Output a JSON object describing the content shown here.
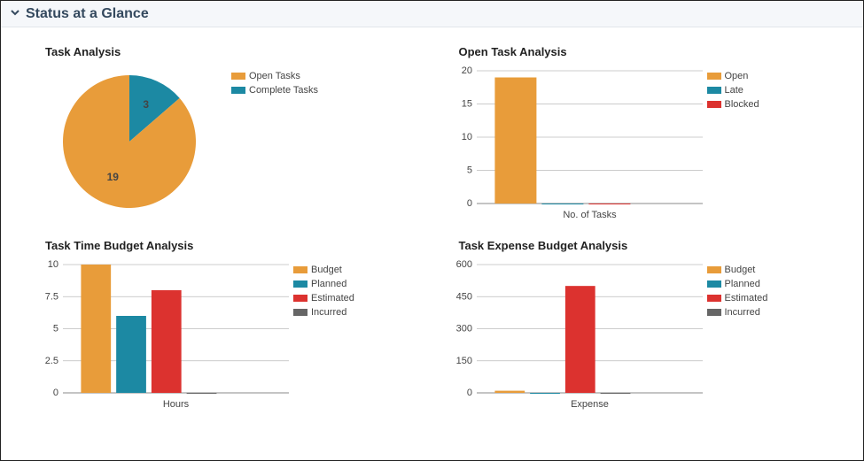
{
  "header": {
    "title": "Status at a Glance",
    "collapsed": false
  },
  "colors": {
    "orange": "#e89c3a",
    "teal": "#1c89a3",
    "red": "#dc322f",
    "gray": "#666666",
    "grid": "#666666",
    "lightgrid": "#cccccc"
  },
  "chart_data": [
    {
      "id": "task_analysis",
      "type": "pie",
      "title": "Task Analysis",
      "slices": [
        {
          "name": "Open Tasks",
          "value": 19,
          "color": "orange",
          "label": "19"
        },
        {
          "name": "Complete Tasks",
          "value": 3,
          "color": "teal",
          "label": "3"
        }
      ],
      "legend": [
        "Open Tasks",
        "Complete Tasks"
      ]
    },
    {
      "id": "open_task_analysis",
      "type": "bar",
      "title": "Open Task Analysis",
      "categories": [
        "No. of Tasks"
      ],
      "series": [
        {
          "name": "Open",
          "values": [
            19
          ],
          "color": "orange"
        },
        {
          "name": "Late",
          "values": [
            0
          ],
          "color": "teal"
        },
        {
          "name": "Blocked",
          "values": [
            0
          ],
          "color": "red"
        }
      ],
      "y_ticks": [
        0,
        5,
        10,
        15,
        20
      ],
      "ylim": [
        0,
        20
      ],
      "xlabel": "No. of Tasks",
      "legend": [
        "Open",
        "Late",
        "Blocked"
      ]
    },
    {
      "id": "task_time_budget",
      "type": "bar",
      "title": "Task Time Budget Analysis",
      "categories": [
        "Hours"
      ],
      "series": [
        {
          "name": "Budget",
          "values": [
            10.0
          ],
          "color": "orange"
        },
        {
          "name": "Planned",
          "values": [
            6.0
          ],
          "color": "teal"
        },
        {
          "name": "Estimated",
          "values": [
            8.0
          ],
          "color": "red"
        },
        {
          "name": "Incurred",
          "values": [
            0.0
          ],
          "color": "gray"
        }
      ],
      "y_ticks": [
        0.0,
        2.5,
        5.0,
        7.5,
        10.0
      ],
      "ylim": [
        0,
        10
      ],
      "xlabel": "Hours",
      "legend": [
        "Budget",
        "Planned",
        "Estimated",
        "Incurred"
      ]
    },
    {
      "id": "task_expense_budget",
      "type": "bar",
      "title": "Task Expense Budget Analysis",
      "categories": [
        "Expense"
      ],
      "series": [
        {
          "name": "Budget",
          "values": [
            10
          ],
          "color": "orange"
        },
        {
          "name": "Planned",
          "values": [
            0
          ],
          "color": "teal"
        },
        {
          "name": "Estimated",
          "values": [
            500
          ],
          "color": "red"
        },
        {
          "name": "Incurred",
          "values": [
            0
          ],
          "color": "gray"
        }
      ],
      "y_ticks": [
        0,
        150,
        300,
        450,
        600
      ],
      "ylim": [
        0,
        600
      ],
      "xlabel": "Expense",
      "legend": [
        "Budget",
        "Planned",
        "Estimated",
        "Incurred"
      ]
    }
  ]
}
